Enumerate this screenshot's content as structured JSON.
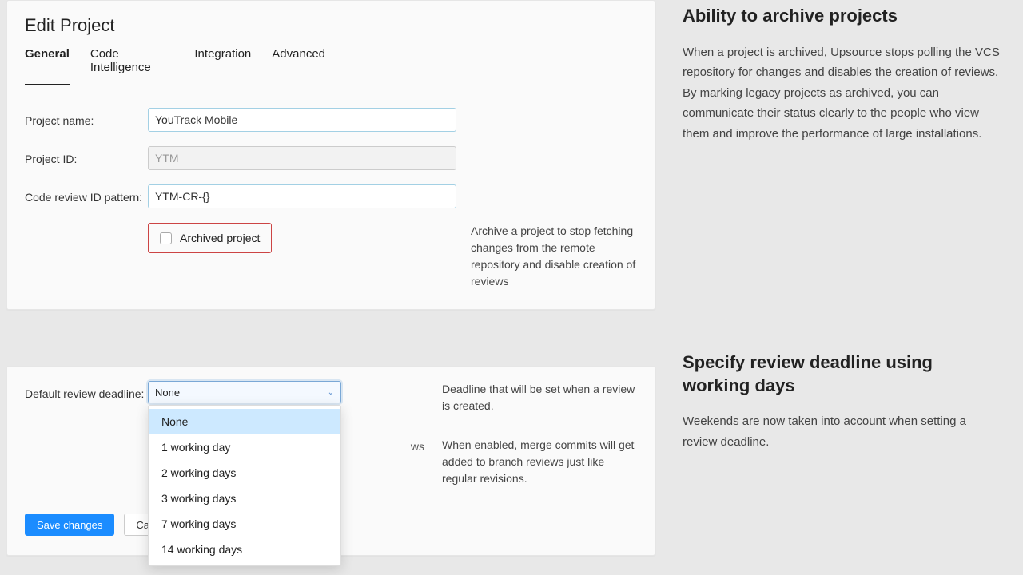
{
  "panel1": {
    "title": "Edit Project",
    "tabs": [
      "General",
      "Code Intelligence",
      "Integration",
      "Advanced"
    ],
    "fields": {
      "project_name": {
        "label": "Project name:",
        "value": "YouTrack Mobile"
      },
      "project_id": {
        "label": "Project ID:",
        "value": "YTM"
      },
      "review_pattern": {
        "label": "Code review ID pattern:",
        "value": "YTM-CR-{}"
      },
      "archived": {
        "label": "Archived project",
        "help": "Archive a project to stop fetching changes from the remote repository and disable creation of reviews"
      }
    }
  },
  "panel2": {
    "deadline": {
      "label": "Default review deadline:",
      "selected": "None",
      "options": [
        "None",
        "1 working day",
        "2 working days",
        "3 working days",
        "7 working days",
        "14 working days"
      ],
      "help1": "Deadline that will be set when a review is created.",
      "help2": "When enabled, merge commits will get added to branch reviews just like regular revisions."
    },
    "hidden_row_text": "ws",
    "buttons": {
      "save": "Save changes",
      "cancel": "Ca"
    }
  },
  "side": {
    "block1": {
      "title": "Ability to archive projects",
      "body": "When a project is archived, Upsource stops polling the VCS repository for changes and disables the creation of reviews. By marking legacy projects as archived, you can communicate their status clearly to the people who view them and improve the performance of large installations."
    },
    "block2": {
      "title": "Specify review deadline using working days",
      "body": "Weekends are now taken into account when setting a review deadline."
    }
  }
}
